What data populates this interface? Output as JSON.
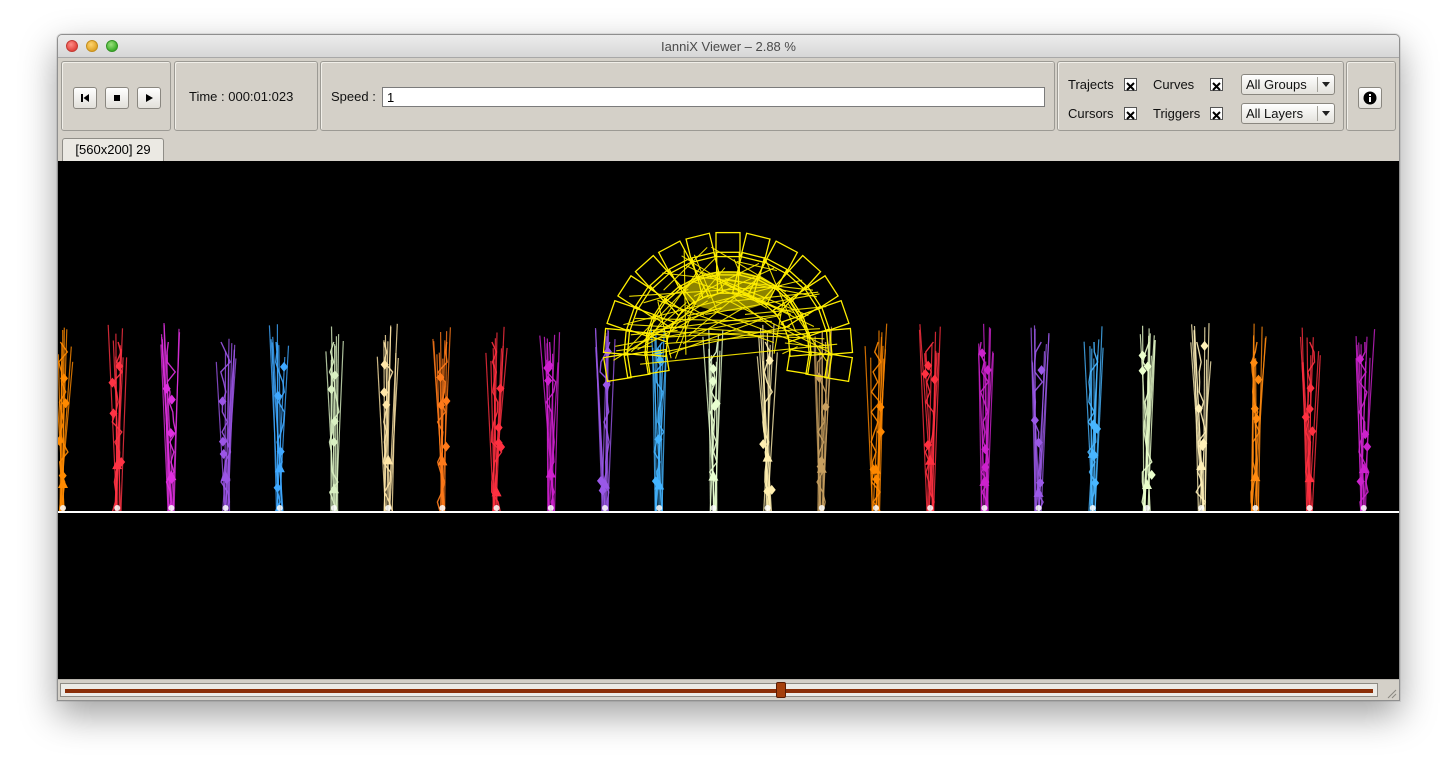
{
  "window": {
    "title": "IanniX Viewer – 2.88 %"
  },
  "transport": {
    "rewind_icon": "rewind-to-start-icon",
    "stop_icon": "stop-icon",
    "play_icon": "play-icon"
  },
  "time": {
    "label": "Time : 000:01:023"
  },
  "speed": {
    "label": "Speed :",
    "value": "1"
  },
  "filters": {
    "trajects": {
      "label": "Trajects",
      "checked": true
    },
    "curves": {
      "label": "Curves",
      "checked": true
    },
    "cursors": {
      "label": "Cursors",
      "checked": true
    },
    "triggers": {
      "label": "Triggers",
      "checked": true
    },
    "groups_selected": "All Groups",
    "layers_selected": "All Layers"
  },
  "info_icon": "info-icon",
  "tabs": [
    {
      "label": "[560x200] 29"
    }
  ],
  "timeline": {
    "position_fraction": 0.547
  },
  "colors": {
    "background": "#000000",
    "arch": "#ffee00",
    "palette": [
      "#ff8a00",
      "#ff3344",
      "#e030e0",
      "#9b55e6",
      "#3fa8ff",
      "#d9f0c2",
      "#ffe6a8",
      "#ff7a1a",
      "#ff3040",
      "#d020d0",
      "#9a58e8",
      "#44b4ff",
      "#e8ffd0",
      "#ffefb0",
      "#c8a060",
      "#ff8800",
      "#ff3040",
      "#cc22cc",
      "#9b59e8",
      "#48b6ff",
      "#eaffcc",
      "#fff0b8",
      "#ff8a10",
      "#ff3040",
      "#cc22cc"
    ]
  }
}
